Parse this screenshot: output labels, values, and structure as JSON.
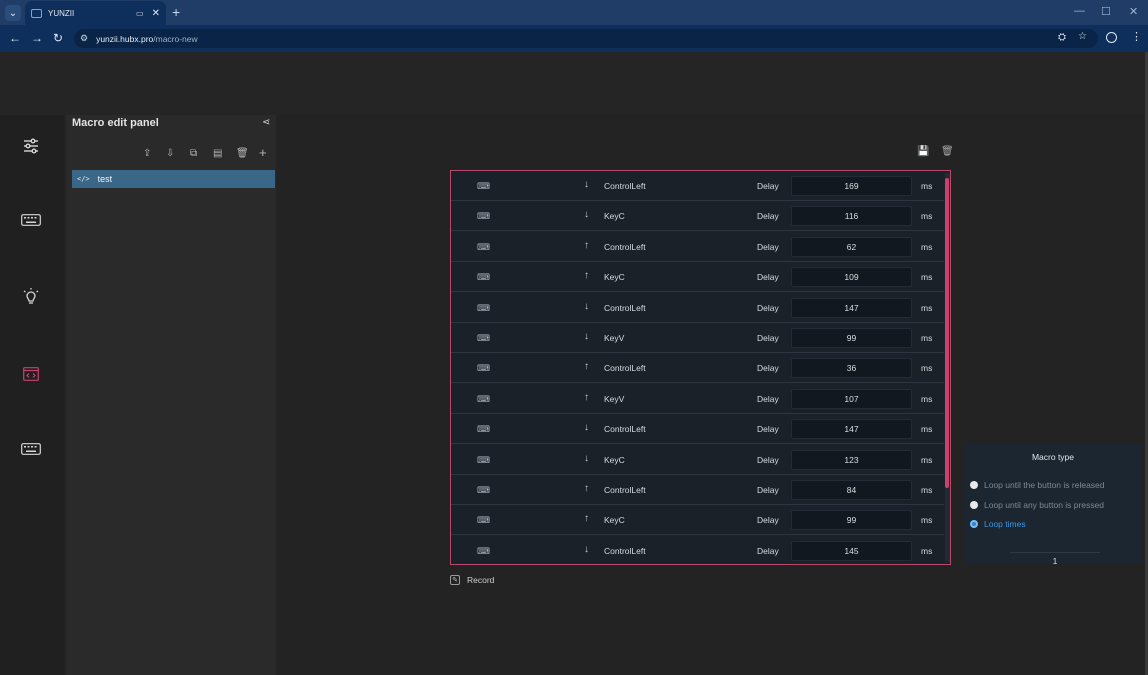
{
  "browser": {
    "tab_title": "YUNZII",
    "tab_mute_icon": "volume-icon",
    "url_host": "yunzii.hubx.pro",
    "url_path": "/macro-new"
  },
  "panel": {
    "title": "Macro edit panel",
    "macros": [
      {
        "label": "test"
      }
    ]
  },
  "steps": [
    {
      "dir": "↓",
      "key": "ControlLeft",
      "delay_label": "Delay",
      "value": "169",
      "unit": "ms"
    },
    {
      "dir": "↓",
      "key": "KeyC",
      "delay_label": "Delay",
      "value": "116",
      "unit": "ms"
    },
    {
      "dir": "↑",
      "key": "ControlLeft",
      "delay_label": "Delay",
      "value": "62",
      "unit": "ms"
    },
    {
      "dir": "↑",
      "key": "KeyC",
      "delay_label": "Delay",
      "value": "109",
      "unit": "ms"
    },
    {
      "dir": "↓",
      "key": "ControlLeft",
      "delay_label": "Delay",
      "value": "147",
      "unit": "ms"
    },
    {
      "dir": "↓",
      "key": "KeyV",
      "delay_label": "Delay",
      "value": "99",
      "unit": "ms"
    },
    {
      "dir": "↑",
      "key": "ControlLeft",
      "delay_label": "Delay",
      "value": "36",
      "unit": "ms"
    },
    {
      "dir": "↑",
      "key": "KeyV",
      "delay_label": "Delay",
      "value": "107",
      "unit": "ms"
    },
    {
      "dir": "↓",
      "key": "ControlLeft",
      "delay_label": "Delay",
      "value": "147",
      "unit": "ms"
    },
    {
      "dir": "↓",
      "key": "KeyC",
      "delay_label": "Delay",
      "value": "123",
      "unit": "ms"
    },
    {
      "dir": "↑",
      "key": "ControlLeft",
      "delay_label": "Delay",
      "value": "84",
      "unit": "ms"
    },
    {
      "dir": "↑",
      "key": "KeyC",
      "delay_label": "Delay",
      "value": "99",
      "unit": "ms"
    },
    {
      "dir": "↓",
      "key": "ControlLeft",
      "delay_label": "Delay",
      "value": "145",
      "unit": "ms"
    }
  ],
  "record": {
    "label": "Record"
  },
  "macro_type": {
    "title": "Macro type",
    "options": [
      {
        "label": "Loop until the button is released",
        "selected": false
      },
      {
        "label": "Loop until any button is pressed",
        "selected": false
      },
      {
        "label": "Loop times",
        "selected": true
      }
    ],
    "loop_count": "1"
  },
  "colors": {
    "accent": "#c9426d",
    "selected": "#3a98e8",
    "macro_item_bg": "#3a6787"
  }
}
